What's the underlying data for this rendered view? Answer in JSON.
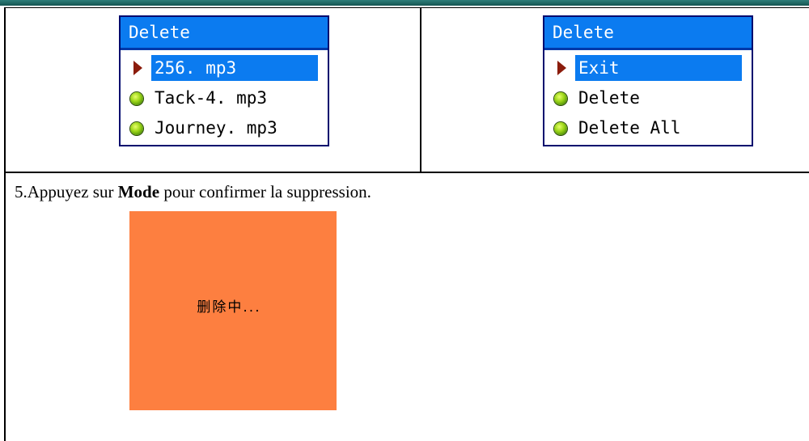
{
  "left_screen": {
    "title": "Delete",
    "items": [
      {
        "label": "256. mp3",
        "selected": true,
        "marker": "triangle-pointer-icon"
      },
      {
        "label": "Tack-4. mp3",
        "selected": false,
        "marker": "green-ball-icon"
      },
      {
        "label": "Journey. mp3",
        "selected": false,
        "marker": "green-ball-icon"
      }
    ]
  },
  "right_screen": {
    "title": "Delete",
    "items": [
      {
        "label": "Exit",
        "selected": true,
        "marker": "triangle-pointer-icon"
      },
      {
        "label": "Delete",
        "selected": false,
        "marker": "green-ball-icon"
      },
      {
        "label": "Delete All",
        "selected": false,
        "marker": "green-ball-icon"
      }
    ]
  },
  "instruction": {
    "prefix": "5.Appuyez sur ",
    "bold": "Mode",
    "suffix": " pour confirmer la suppression."
  },
  "popup": {
    "text": "删除中..."
  },
  "colors": {
    "title_bar": "#0b7bf0",
    "selection": "#0b7bf0",
    "pointer": "#8b1c0c",
    "popup_bg": "#fd7f40",
    "top_bar": "#1f6a66"
  }
}
